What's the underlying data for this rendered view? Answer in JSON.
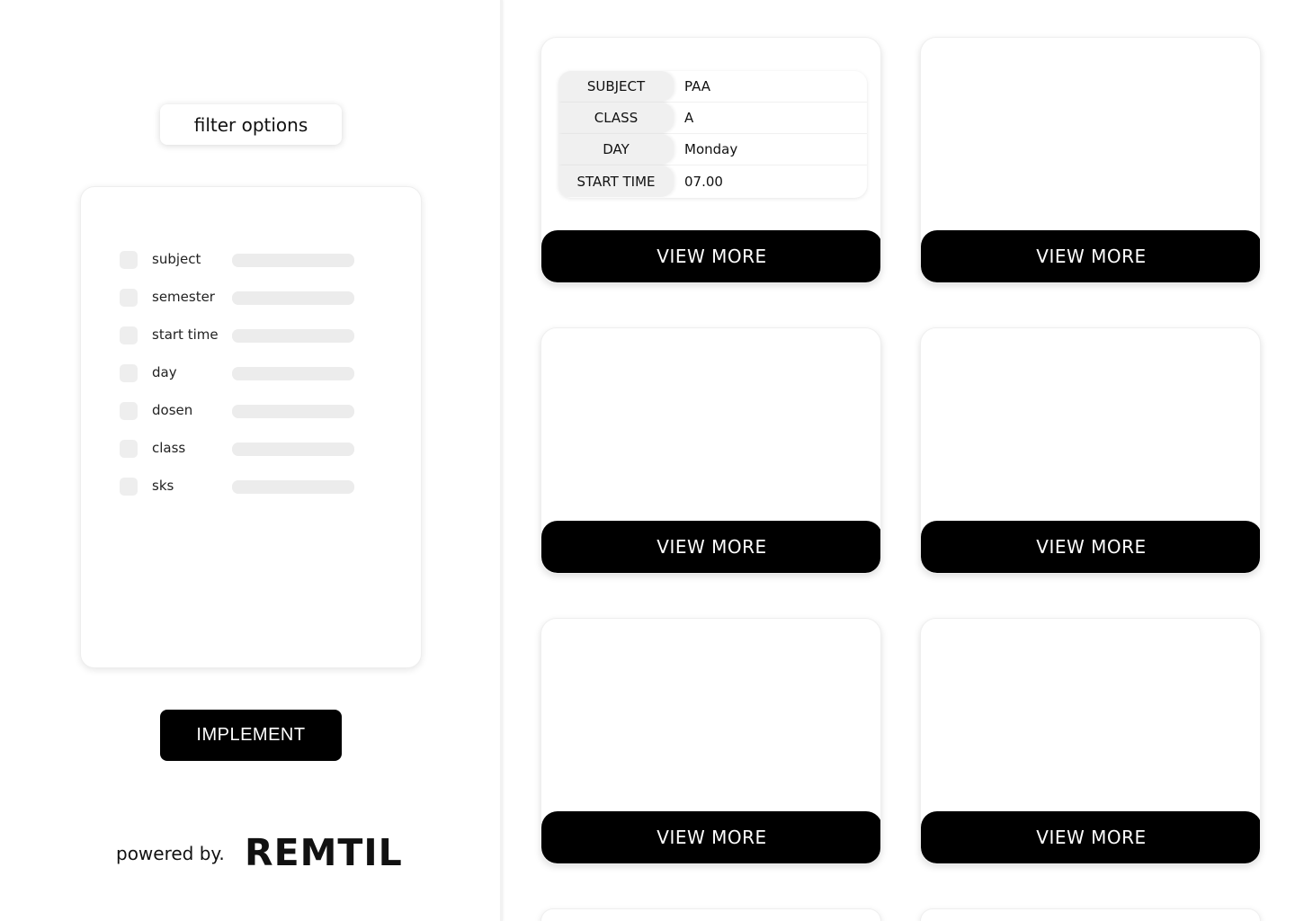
{
  "sidebar": {
    "filter_title": "filter options",
    "filters": [
      {
        "label": "subject"
      },
      {
        "label": "semester"
      },
      {
        "label": "start time"
      },
      {
        "label": "day"
      },
      {
        "label": "dosen"
      },
      {
        "label": "class"
      },
      {
        "label": "sks"
      }
    ],
    "implement_label": "IMPLEMENT",
    "powered_by": "powered by.",
    "brand": "REMTIL"
  },
  "cards": [
    {
      "details": [
        {
          "key": "SUBJECT",
          "value": "PAA"
        },
        {
          "key": "CLASS",
          "value": "A"
        },
        {
          "key": "DAY",
          "value": "Monday"
        },
        {
          "key": "START TIME",
          "value": "07.00"
        }
      ],
      "button_label": "VIEW MORE"
    },
    {
      "button_label": "VIEW MORE"
    },
    {
      "button_label": "VIEW MORE"
    },
    {
      "button_label": "VIEW MORE"
    },
    {
      "button_label": "VIEW MORE"
    },
    {
      "button_label": "VIEW MORE"
    }
  ],
  "colors": {
    "button_bg": "#000000",
    "button_text": "#ffffff",
    "placeholder": "#ececec"
  }
}
